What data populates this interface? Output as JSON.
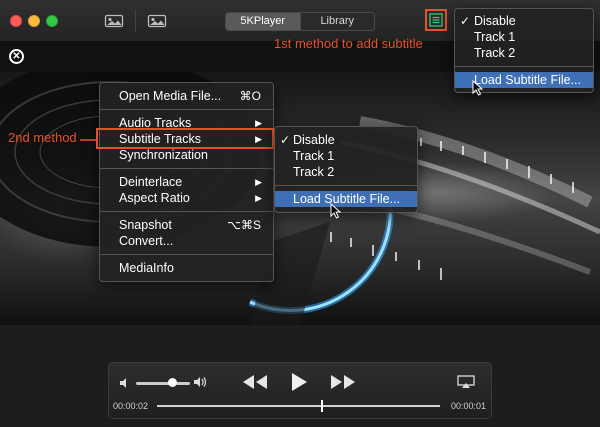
{
  "titlebar": {
    "tabs": [
      {
        "label": "5KPlayer",
        "active": true
      },
      {
        "label": "Library",
        "active": false
      }
    ]
  },
  "context_menu": {
    "items": [
      {
        "label": "Open Media File...",
        "shortcut": "⌘O"
      },
      {
        "label": "Audio Tracks",
        "submenu": true
      },
      {
        "label": "Subtitle Tracks",
        "submenu": true
      },
      {
        "label": "Synchronization"
      },
      {
        "label": "Deinterlace",
        "submenu": true
      },
      {
        "label": "Aspect Ratio",
        "submenu": true
      },
      {
        "label": "Snapshot",
        "shortcut": "⌥⌘S"
      },
      {
        "label": "Convert..."
      },
      {
        "label": "MediaInfo"
      }
    ]
  },
  "subtitle_submenu": {
    "items": [
      {
        "label": "Disable",
        "checked": true
      },
      {
        "label": "Track 1"
      },
      {
        "label": "Track 2"
      },
      {
        "label": "Load Subtitle File...",
        "highlighted": true
      }
    ]
  },
  "subtitle_dropdown": {
    "items": [
      {
        "label": "Disable",
        "checked": true
      },
      {
        "label": "Track 1"
      },
      {
        "label": "Track 2"
      },
      {
        "label": "Load Subtitle File...",
        "highlighted": true
      }
    ]
  },
  "annotations": {
    "first": "1st method to add subtitle",
    "second": "2nd method"
  },
  "player": {
    "elapsed": "00:00:02",
    "remaining": "00:00:01",
    "progress_fraction": 0.58,
    "volume_fraction": 0.68
  },
  "colors": {
    "annotation": "#e8502b",
    "menu_highlight": "#3f6fb4"
  },
  "icons": {
    "checkmark": "✓",
    "submenu_arrow": "▶",
    "close": "✕"
  }
}
